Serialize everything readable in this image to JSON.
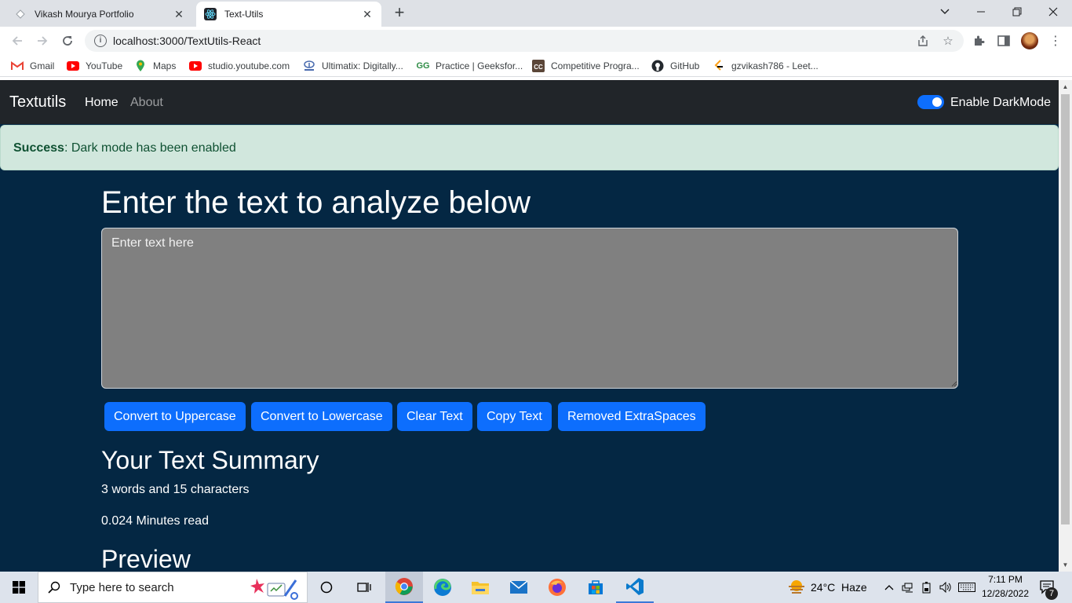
{
  "browser": {
    "tabs": [
      {
        "title": "Vikash Mourya Portfolio",
        "active": false
      },
      {
        "title": "Text-Utils",
        "active": true
      }
    ],
    "url": "localhost:3000/TextUtils-React",
    "bookmarks": [
      {
        "label": "Gmail",
        "icon": "gmail-icon"
      },
      {
        "label": "YouTube",
        "icon": "youtube-icon"
      },
      {
        "label": "Maps",
        "icon": "maps-icon"
      },
      {
        "label": "studio.youtube.com",
        "icon": "youtube-studio-icon"
      },
      {
        "label": "Ultimatix: Digitally...",
        "icon": "tata-icon"
      },
      {
        "label": "Practice | Geeksfor...",
        "icon": "geeksforgeeks-icon"
      },
      {
        "label": "Competitive Progra...",
        "icon": "codechef-icon"
      },
      {
        "label": "GitHub",
        "icon": "github-icon"
      },
      {
        "label": "gzvikash786 - Leet...",
        "icon": "leetcode-icon"
      }
    ]
  },
  "app": {
    "brand": "Textutils",
    "nav": {
      "home": "Home",
      "about": "About"
    },
    "dark_mode_label": "Enable DarkMode",
    "dark_mode_on": true,
    "alert": {
      "type": "Success",
      "message": ": Dark mode has been enabled"
    },
    "heading": "Enter the text to analyze below",
    "textarea_placeholder": "Enter text here",
    "buttons": {
      "uppercase": "Convert to Uppercase",
      "lowercase": "Convert to Lowercase",
      "clear": "Clear Text",
      "copy": "Copy Text",
      "extra_spaces": "Removed ExtraSpaces"
    },
    "summary_title": "Your Text Summary",
    "summary_counts": "3 words and 15 characters",
    "summary_read": "0.024 Minutes read",
    "preview_title": "Preview",
    "colors": {
      "page_bg": "#042743",
      "navbar": "#212529",
      "primary": "#0d6efd",
      "alert_bg": "#d1e7dd",
      "alert_text": "#0f5132",
      "textarea_bg": "#808080"
    }
  },
  "taskbar": {
    "search_placeholder": "Type here to search",
    "weather_temp": "24°C",
    "weather_desc": "Haze",
    "time": "7:11 PM",
    "date": "12/28/2022",
    "notifications": "7"
  }
}
